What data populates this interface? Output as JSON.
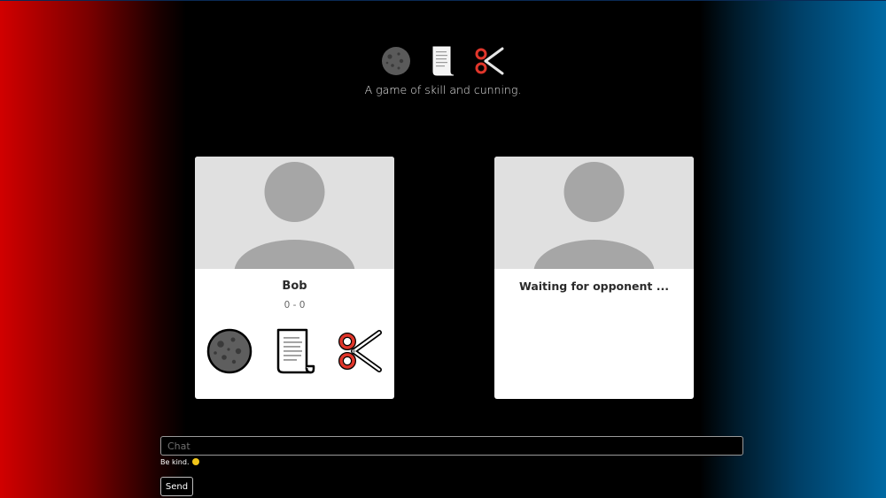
{
  "header": {
    "icons": [
      "moon-rock-icon",
      "paper-scroll-icon",
      "scissors-icon"
    ],
    "tagline": "A game of skill and cunning."
  },
  "player": {
    "name": "Bob",
    "score": "0 - 0",
    "choices": [
      "rock-icon",
      "paper-icon",
      "scissors-icon"
    ]
  },
  "opponent": {
    "status": "Waiting for opponent ..."
  },
  "chat": {
    "placeholder": "Chat",
    "value": "",
    "hint": "Be kind.",
    "hint_emoji": "smiley-icon",
    "send_label": "Send"
  },
  "colors": {
    "left_gradient": "#d10000",
    "right_gradient": "#0069a3",
    "background": "#000000",
    "card": "#ffffff",
    "avatar_bg": "#e0e0e0",
    "avatar_fg": "#a6a6a6",
    "scissors_red": "#e0362b"
  }
}
